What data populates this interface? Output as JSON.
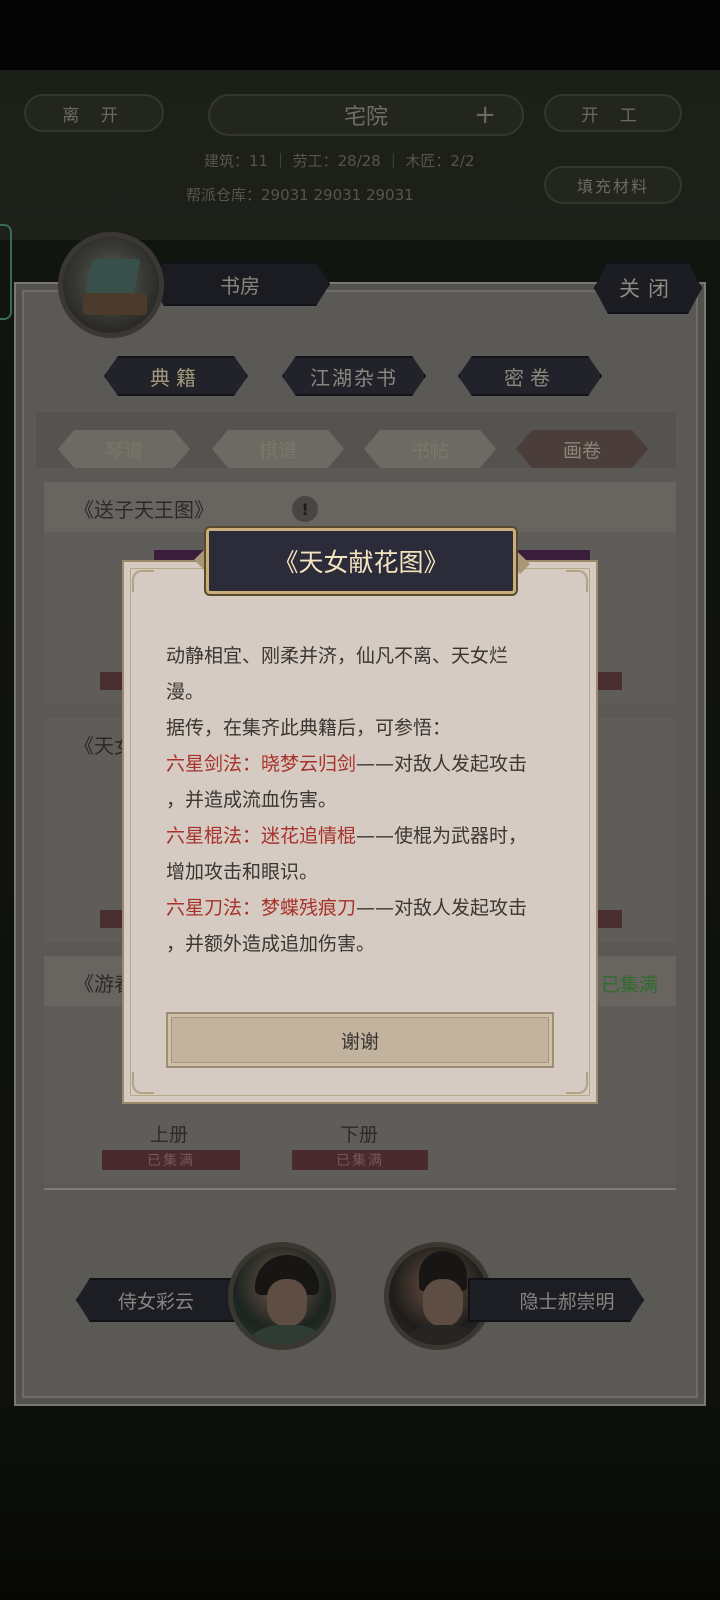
{
  "hud": {
    "leave": "离 开",
    "location": "宅院",
    "start_work": "开 工",
    "stats": "建筑：11 ｜ 劳工：28/28 ｜ 木匠：2/2",
    "storage": "帮派仓库：29031    29031    29031",
    "fill_materials": "填充材料"
  },
  "panel": {
    "room_title": "书房",
    "close": "关闭",
    "categories": [
      "典籍",
      "江湖杂书",
      "密卷"
    ],
    "sub_tabs": [
      "琴谱",
      "棋谱",
      "书帖",
      "画卷"
    ],
    "books": [
      {
        "name": "《送子天王图》",
        "badge": "!"
      },
      {
        "name": "《天女献花图》"
      },
      {
        "name": "《游春图》",
        "status": "已集满"
      }
    ],
    "volumes": [
      {
        "label": "上册",
        "stamp": "已集满"
      },
      {
        "label": "下册",
        "stamp": "已集满"
      }
    ],
    "npcs": [
      {
        "name": "侍女彩云"
      },
      {
        "name": "隐士郝崇明"
      }
    ]
  },
  "dialog": {
    "title": "《天女献花图》",
    "lines": [
      {
        "text": "动静相宜、刚柔并济，仙凡不离、天女烂"
      },
      {
        "text": "漫。"
      },
      {
        "text": "据传，在集齐此典籍后，可参悟："
      },
      {
        "red": "六星剑法：晓梦云归剑",
        "text": "——对敌人发起攻击"
      },
      {
        "text": "，并造成流血伤害。"
      },
      {
        "red": "六星棍法：迷花追情棍",
        "text": "——使棍为武器时，"
      },
      {
        "text": "增加攻击和眼识。"
      },
      {
        "red": "六星刀法：梦蝶残痕刀",
        "text": "——对敌人发起攻击"
      },
      {
        "text": "，并额外造成追加伤害。"
      }
    ],
    "button": "谢谢"
  },
  "colors": {
    "dialog_bg": "#d5cbc2",
    "title_plate": "#2b2b39",
    "title_text": "#f3e3be",
    "skill_red": "#a8322b",
    "collected_green": "#2f6d2b"
  }
}
